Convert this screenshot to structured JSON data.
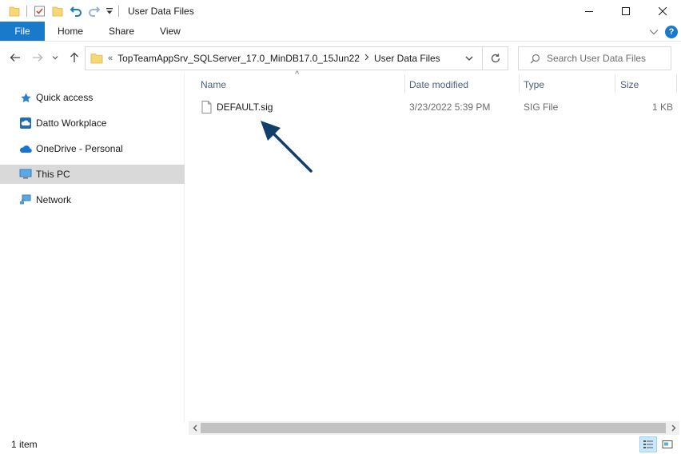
{
  "window": {
    "title": "User Data Files",
    "controls": [
      "minimize",
      "maximize",
      "close"
    ]
  },
  "quick_access_toolbar": {
    "items": [
      "folder-icon",
      "properties-icon",
      "new-folder-icon",
      "undo-icon",
      "redo-icon",
      "customize-dropdown-icon"
    ]
  },
  "ribbon": {
    "tabs": [
      {
        "label": "File",
        "active": true
      },
      {
        "label": "Home"
      },
      {
        "label": "Share"
      },
      {
        "label": "View"
      }
    ]
  },
  "address": {
    "overflow_marker": "«",
    "crumbs": [
      "TopTeamAppSrv_SQLServer_17.0_MinDB17.0_15Jun22",
      "User Data Files"
    ]
  },
  "search": {
    "placeholder": "Search User Data Files"
  },
  "nav_pane": {
    "items": [
      {
        "label": "Quick access",
        "icon": "star-icon"
      },
      {
        "label": "Datto Workplace",
        "icon": "cloud-sync-icon"
      },
      {
        "label": "OneDrive - Personal",
        "icon": "onedrive-cloud-icon"
      },
      {
        "label": "This PC",
        "icon": "computer-icon",
        "selected": true
      },
      {
        "label": "Network",
        "icon": "network-icon"
      }
    ]
  },
  "file_list": {
    "columns": [
      "Name",
      "Date modified",
      "Type",
      "Size"
    ],
    "sort_indicator": "^",
    "rows": [
      {
        "name": "DEFAULT.sig",
        "date_modified": "3/23/2022 5:39 PM",
        "type": "SIG File",
        "size": "1 KB"
      }
    ]
  },
  "status_bar": {
    "item_count": "1 item"
  },
  "colors": {
    "accent": "#1979ca",
    "annotation_arrow": "#123f69",
    "selection": "#d9d9d9"
  }
}
